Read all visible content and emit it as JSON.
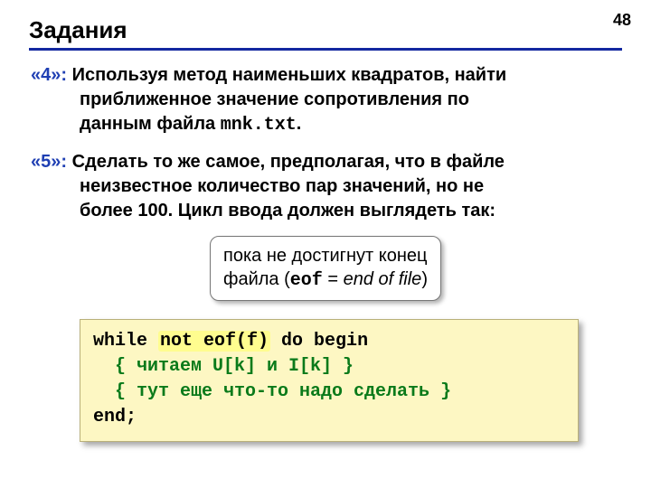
{
  "page_number": "48",
  "title": "Задания",
  "task4": {
    "label": "«4»:",
    "line1_a": "Используя метод наименьших квадратов, найти",
    "line2": "приближенное значение сопротивления по",
    "line3_a": "данным файла ",
    "line3_mono": "mnk.txt",
    "line3_b": "."
  },
  "task5": {
    "label": "«5»:",
    "line1_a": "Сделать то же самое, предполагая, что в файле",
    "line2": "неизвестное количество пар значений, но не",
    "line3": "более 100. Цикл ввода должен выглядеть так:"
  },
  "callout": {
    "line1": "пока не достигнут конец",
    "line2_a": "файла (",
    "line2_mono": "eof",
    "line2_b": " = ",
    "line2_italic": "end of file",
    "line2_c": ")"
  },
  "code": {
    "l1_a": "while ",
    "l1_hl": "not eof(f)",
    "l1_b": " do begin",
    "l2": "  { читаем U[k] и I[k] }",
    "l3": "  { тут еще что-то надо сделать }",
    "l4": "end;"
  }
}
